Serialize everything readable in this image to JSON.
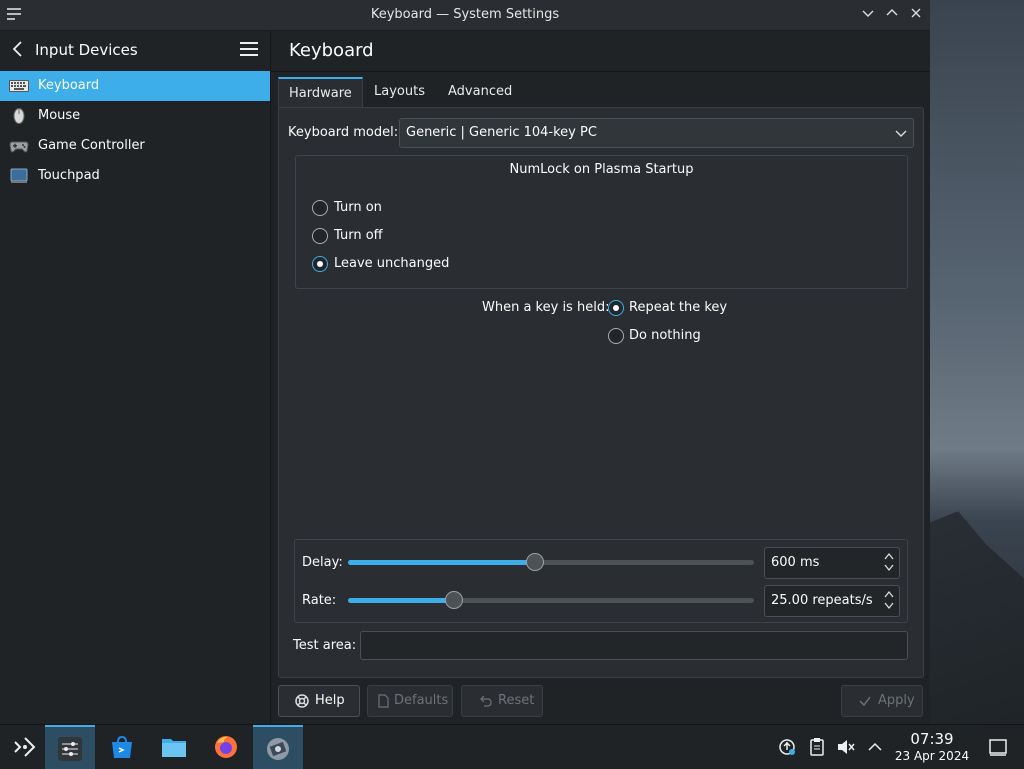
{
  "window": {
    "title": "Keyboard — System Settings",
    "controls": [
      "minimize",
      "maximize",
      "close"
    ]
  },
  "sidebar": {
    "title": "Input Devices",
    "items": [
      {
        "label": "Keyboard",
        "icon": "keyboard-icon",
        "active": true
      },
      {
        "label": "Mouse",
        "icon": "mouse-icon",
        "active": false
      },
      {
        "label": "Game Controller",
        "icon": "gamepad-icon",
        "active": false
      },
      {
        "label": "Touchpad",
        "icon": "touchpad-icon",
        "active": false
      }
    ]
  },
  "main": {
    "title": "Keyboard",
    "tabs": [
      {
        "label": "Hardware",
        "active": true
      },
      {
        "label": "Layouts",
        "active": false
      },
      {
        "label": "Advanced",
        "active": false
      }
    ],
    "keyboard_model": {
      "label": "Keyboard model:",
      "value": "Generic | Generic 104-key PC"
    },
    "numlock": {
      "title": "NumLock on Plasma Startup",
      "options": [
        {
          "label": "Turn on",
          "checked": false
        },
        {
          "label": "Turn off",
          "checked": false
        },
        {
          "label": "Leave unchanged",
          "checked": true
        }
      ]
    },
    "key_held": {
      "label": "When a key is held:",
      "options": [
        {
          "label": "Repeat the key",
          "checked": true
        },
        {
          "label": "Do nothing",
          "checked": false
        }
      ]
    },
    "delay": {
      "label": "Delay:",
      "value": "600 ms",
      "slider_fraction": 0.46
    },
    "rate": {
      "label": "Rate:",
      "value": "25.00 repeats/s",
      "slider_fraction": 0.26
    },
    "test_area": {
      "label": "Test area:",
      "value": ""
    },
    "buttons": {
      "help": "Help",
      "defaults": "Defaults",
      "reset": "Reset",
      "apply": "Apply"
    }
  },
  "taskbar": {
    "apps": [
      "application-launcher-icon",
      "system-settings-icon",
      "discover-store-icon",
      "file-manager-icon",
      "firefox-icon",
      "video-app-icon"
    ],
    "clock": {
      "time": "07:39",
      "date": "23 Apr 2024"
    }
  },
  "colors": {
    "accent": "#3daee9",
    "window_bg": "#202326",
    "panel_bg": "#2a2e32"
  }
}
